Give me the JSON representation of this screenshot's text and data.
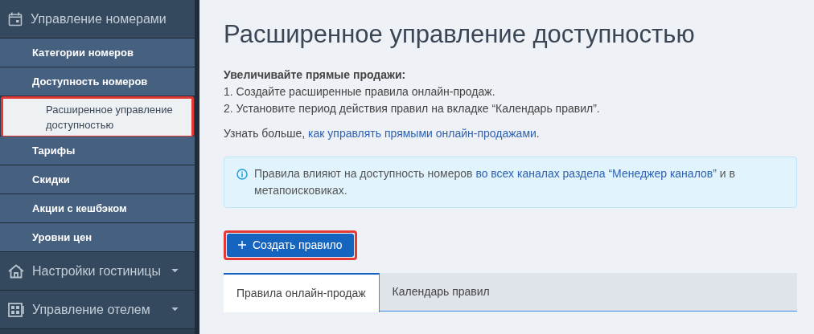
{
  "sidebar": {
    "sections": [
      {
        "label": "Управление номерами",
        "expanded": true,
        "items": [
          {
            "label": "Категории номеров",
            "selected": false,
            "highlighted": false
          },
          {
            "label": "Доступность номеров",
            "selected": false,
            "highlighted": false,
            "children": [
              {
                "label": "Расширенное управление доступностью",
                "selected": true,
                "highlighted": true
              }
            ]
          },
          {
            "label": "Тарифы",
            "selected": false,
            "highlighted": false
          },
          {
            "label": "Скидки",
            "selected": false,
            "highlighted": false
          },
          {
            "label": "Акции с кешбэком",
            "selected": false,
            "highlighted": false
          },
          {
            "label": "Уровни цен",
            "selected": false,
            "highlighted": false
          }
        ]
      },
      {
        "label": "Настройки гостиницы",
        "expanded": false
      },
      {
        "label": "Управление отелем",
        "expanded": false
      }
    ]
  },
  "page": {
    "title": "Расширенное управление доступностью",
    "intro": {
      "heading": "Увеличивайте прямые продажи:",
      "steps": [
        "1. Создайте расширенные правила онлайн-продаж.",
        "2. Установите период действия правил на вкладке “Календарь правил”."
      ]
    },
    "learn_more": {
      "text": "Узнать больше, ",
      "link": "как управлять прямыми онлайн-продажами",
      "end": "."
    },
    "info": {
      "text": "Правила влияют на доступность номеров ",
      "link": "во всех каналах раздела “Менеджер каналов”",
      "end": " и в метапоисковиках."
    },
    "create_button": {
      "label": "Создать правило",
      "highlighted": true
    },
    "tabs": [
      {
        "label": "Правила онлайн-продаж",
        "selected": true
      },
      {
        "label": "Календарь правил",
        "selected": false
      }
    ]
  }
}
